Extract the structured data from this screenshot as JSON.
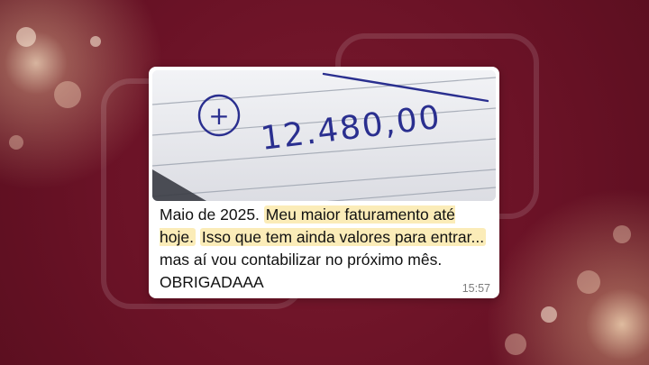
{
  "message": {
    "photo": {
      "sign_symbol": "+",
      "amount": "12.480,00"
    },
    "text": {
      "part1": "Maio de 2025.",
      "highlight1": "Meu maior faturamento até hoje.",
      "highlight2": "Isso que tem ainda valores para entrar...",
      "part2": "mas aí vou contabilizar no próximo mês. OBRIGADAAA"
    },
    "timestamp": "15:57"
  },
  "colors": {
    "background": "#6e1428",
    "highlight": "#fbecb8",
    "ink": "#2a2f8f"
  }
}
